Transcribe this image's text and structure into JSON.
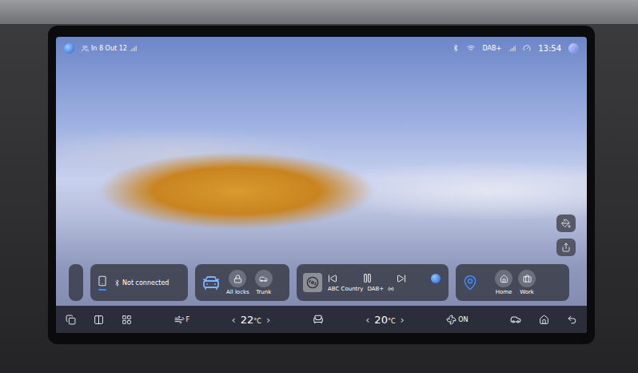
{
  "status_bar": {
    "passengers": "In 8 Out 12",
    "radio": "DAB+",
    "time": "13:54"
  },
  "widgets": {
    "phone": {
      "status": "Not connected"
    },
    "vehicle": {
      "actions": [
        {
          "label": "All locks",
          "kind": "lock"
        },
        {
          "label": "Trunk",
          "kind": "trunk"
        }
      ]
    },
    "media": {
      "station": "ABC Country",
      "source": "DAB+",
      "playing": true
    },
    "navigation": {
      "destinations": [
        {
          "label": "Home",
          "kind": "home"
        },
        {
          "label": "Work",
          "kind": "work"
        }
      ]
    }
  },
  "climate": {
    "defrost_label": "F",
    "left_arrow": "‹",
    "right_arrow": "›",
    "driver_temp": "22",
    "passenger_temp": "20",
    "unit": "°C",
    "fan": "ON"
  }
}
